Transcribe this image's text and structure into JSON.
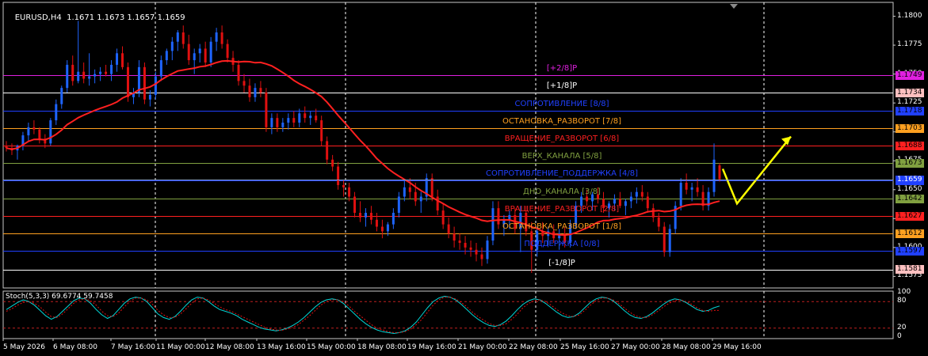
{
  "header": {
    "symbol": "EURUSD,H4",
    "ohlc": "1.1671 1.1673 1.1657 1.1659"
  },
  "stoch_header": "Stoch(5,3,3) 69.6774 59.7458",
  "colors": {
    "background": "#000000",
    "bull": "#1e64ff",
    "bear": "#e01010",
    "ma": "#ff2020",
    "stoch_main": "#00d8d8",
    "stoch_signal": "#e01010",
    "arrow": "#ffff00",
    "grid": "#ffffff"
  },
  "price_axis": {
    "ticks": [
      "1.1800",
      "1.1775",
      "1.1750",
      "1.1725",
      "1.1700",
      "1.1675",
      "1.1650",
      "1.1625",
      "1.1600",
      "1.1575"
    ],
    "min": 1.1565,
    "max": 1.1812
  },
  "stoch_axis": {
    "ticks": [
      "100",
      "80",
      "20",
      "0"
    ],
    "levels": [
      20,
      80
    ]
  },
  "levels": [
    {
      "label": "[+2/8]P",
      "price": 1.1749,
      "tag": "1.1749",
      "color": "#e020e0",
      "tagbg": "#e020e0"
    },
    {
      "label": "[+1/8]P",
      "price": 1.1734,
      "tag": "1.1734",
      "color": "#ffffff",
      "tagbg": "#ffc0c0"
    },
    {
      "label": "СОПРОТИВЛЕНИЕ [8/8]",
      "price": 1.1718,
      "tag": "1.1718",
      "color": "#2040ff",
      "tagbg": "#2040ff"
    },
    {
      "label": "ОСТАНОВКА_РАЗВОРОТ [7/8]",
      "price": 1.1703,
      "tag": "1.1703",
      "color": "#ffa020",
      "tagbg": "#ffa020"
    },
    {
      "label": "ВРАЩЕНИЕ_РАЗВОРОТ [6/8]",
      "price": 1.1688,
      "tag": "1.1688",
      "color": "#ff2020",
      "tagbg": "#ff2020"
    },
    {
      "label": "ВЕРХ_КАНАЛА [5/8]",
      "price": 1.1673,
      "tag": "1.1673",
      "color": "#80a040",
      "tagbg": "#80a040"
    },
    {
      "label": "СОПРОТИВЛЕНИЕ_ПОДДЕРЖКА [4/8]",
      "price": 1.1658,
      "tag": "1.1658",
      "color": "#2040ff",
      "tagbg": "#2040ff"
    },
    {
      "label": "ДНО_КАНАЛА [3/8]",
      "price": 1.1642,
      "tag": "1.1642",
      "color": "#80a040",
      "tagbg": "#80a040"
    },
    {
      "label": "ВРАЩЕНИЕ_РАЗВОРОТ [2/8]",
      "price": 1.1627,
      "tag": "1.1627",
      "color": "#ff2020",
      "tagbg": "#ff2020"
    },
    {
      "label": "ОСТАНОВКА_РАЗВОРОТ [1/8]",
      "price": 1.1612,
      "tag": "1.1612",
      "color": "#ffa020",
      "tagbg": "#ffa020"
    },
    {
      "label": "ПОДДЕРЖКА [0/8]",
      "price": 1.1597,
      "tag": "1.1597",
      "color": "#2040ff",
      "tagbg": "#2040ff"
    },
    {
      "label": "[-1/8]P",
      "price": 1.1581,
      "tag": "1.1581",
      "color": "#ffffff",
      "tagbg": "#ffc0c0"
    }
  ],
  "current_price": {
    "price": 1.1659,
    "tag": "1.1659"
  },
  "time_axis": [
    "5 May 2026",
    "6 May 08:00",
    "7 May 16:00",
    "11 May 00:00",
    "12 May 08:00",
    "13 May 16:00",
    "15 May 00:00",
    "18 May 08:00",
    "19 May 16:00",
    "21 May 00:00",
    "22 May 08:00",
    "25 May 16:00",
    "27 May 00:00",
    "28 May 08:00",
    "29 May 16:00"
  ],
  "chart_data": {
    "type": "candlestick",
    "candles": [
      [
        1.1688,
        1.1692,
        1.1683,
        1.1686
      ],
      [
        1.1686,
        1.169,
        1.168,
        1.1684
      ],
      [
        1.1684,
        1.1689,
        1.1676,
        1.1688
      ],
      [
        1.1688,
        1.17,
        1.1684,
        1.1697
      ],
      [
        1.1697,
        1.1708,
        1.1692,
        1.1704
      ],
      [
        1.1704,
        1.171,
        1.1698,
        1.1702
      ],
      [
        1.1702,
        1.1704,
        1.169,
        1.1694
      ],
      [
        1.1694,
        1.1698,
        1.1686,
        1.169
      ],
      [
        1.169,
        1.1712,
        1.1688,
        1.171
      ],
      [
        1.171,
        1.1728,
        1.1706,
        1.1724
      ],
      [
        1.1724,
        1.174,
        1.172,
        1.1738
      ],
      [
        1.1738,
        1.1762,
        1.1734,
        1.1758
      ],
      [
        1.1758,
        1.1766,
        1.174,
        1.1744
      ],
      [
        1.1744,
        1.1796,
        1.1742,
        1.1752
      ],
      [
        1.1752,
        1.176,
        1.1742,
        1.1746
      ],
      [
        1.1746,
        1.1768,
        1.174,
        1.1748
      ],
      [
        1.1748,
        1.1754,
        1.1742,
        1.175
      ],
      [
        1.175,
        1.1756,
        1.1744,
        1.1752
      ],
      [
        1.1752,
        1.1758,
        1.1748,
        1.175
      ],
      [
        1.175,
        1.1762,
        1.1744,
        1.1758
      ],
      [
        1.1758,
        1.1772,
        1.1752,
        1.1768
      ],
      [
        1.1768,
        1.1774,
        1.1754,
        1.1756
      ],
      [
        1.1756,
        1.176,
        1.1726,
        1.173
      ],
      [
        1.173,
        1.1738,
        1.1724,
        1.1734
      ],
      [
        1.1734,
        1.1762,
        1.173,
        1.1756
      ],
      [
        1.1756,
        1.176,
        1.1724,
        1.1728
      ],
      [
        1.1728,
        1.1736,
        1.1722,
        1.1732
      ],
      [
        1.1732,
        1.1752,
        1.1728,
        1.1748
      ],
      [
        1.1748,
        1.1766,
        1.1744,
        1.1762
      ],
      [
        1.1762,
        1.1772,
        1.1758,
        1.177
      ],
      [
        1.177,
        1.1782,
        1.1762,
        1.1778
      ],
      [
        1.1778,
        1.1788,
        1.177,
        1.1786
      ],
      [
        1.1786,
        1.1792,
        1.1772,
        1.1776
      ],
      [
        1.1776,
        1.1784,
        1.1758,
        1.1762
      ],
      [
        1.1762,
        1.1772,
        1.175,
        1.1768
      ],
      [
        1.1768,
        1.1776,
        1.176,
        1.1772
      ],
      [
        1.1772,
        1.1778,
        1.1756,
        1.176
      ],
      [
        1.176,
        1.1782,
        1.1756,
        1.1778
      ],
      [
        1.1778,
        1.179,
        1.177,
        1.1786
      ],
      [
        1.1786,
        1.1792,
        1.1772,
        1.1776
      ],
      [
        1.1776,
        1.178,
        1.176,
        1.1764
      ],
      [
        1.1764,
        1.177,
        1.1752,
        1.1758
      ],
      [
        1.1758,
        1.1762,
        1.174,
        1.1744
      ],
      [
        1.1744,
        1.175,
        1.1734,
        1.174
      ],
      [
        1.174,
        1.1746,
        1.1726,
        1.173
      ],
      [
        1.173,
        1.1742,
        1.1726,
        1.1738
      ],
      [
        1.1738,
        1.1744,
        1.173,
        1.1734
      ],
      [
        1.1734,
        1.1738,
        1.17,
        1.1704
      ],
      [
        1.1704,
        1.1716,
        1.1698,
        1.1712
      ],
      [
        1.1712,
        1.1716,
        1.17,
        1.1704
      ],
      [
        1.1704,
        1.1712,
        1.17,
        1.1708
      ],
      [
        1.1708,
        1.1716,
        1.1702,
        1.1712
      ],
      [
        1.1712,
        1.1718,
        1.1704,
        1.1708
      ],
      [
        1.1708,
        1.172,
        1.1704,
        1.1716
      ],
      [
        1.1716,
        1.1722,
        1.1708,
        1.1712
      ],
      [
        1.1712,
        1.1718,
        1.1706,
        1.1714
      ],
      [
        1.1714,
        1.172,
        1.1708,
        1.171
      ],
      [
        1.171,
        1.1714,
        1.1688,
        1.1692
      ],
      [
        1.1692,
        1.1696,
        1.1672,
        1.1676
      ],
      [
        1.1676,
        1.168,
        1.1666,
        1.167
      ],
      [
        1.167,
        1.1674,
        1.165,
        1.1654
      ],
      [
        1.1654,
        1.1658,
        1.1644,
        1.1652
      ],
      [
        1.1652,
        1.1656,
        1.164,
        1.1644
      ],
      [
        1.1644,
        1.1648,
        1.1626,
        1.163
      ],
      [
        1.163,
        1.164,
        1.1622,
        1.1626
      ],
      [
        1.1626,
        1.1634,
        1.1618,
        1.163
      ],
      [
        1.163,
        1.1636,
        1.162,
        1.1624
      ],
      [
        1.1624,
        1.163,
        1.1614,
        1.1618
      ],
      [
        1.1618,
        1.1624,
        1.1608,
        1.1614
      ],
      [
        1.1614,
        1.1622,
        1.161,
        1.162
      ],
      [
        1.162,
        1.1634,
        1.1616,
        1.163
      ],
      [
        1.163,
        1.1648,
        1.1626,
        1.1644
      ],
      [
        1.1644,
        1.1658,
        1.164,
        1.1652
      ],
      [
        1.1652,
        1.166,
        1.1642,
        1.1648
      ],
      [
        1.1648,
        1.1656,
        1.1636,
        1.164
      ],
      [
        1.164,
        1.1648,
        1.163,
        1.1644
      ],
      [
        1.1644,
        1.1664,
        1.164,
        1.166
      ],
      [
        1.166,
        1.1664,
        1.164,
        1.1644
      ],
      [
        1.1644,
        1.165,
        1.1628,
        1.1632
      ],
      [
        1.1632,
        1.1638,
        1.1616,
        1.162
      ],
      [
        1.162,
        1.1626,
        1.1608,
        1.1612
      ],
      [
        1.1612,
        1.1618,
        1.16,
        1.1606
      ],
      [
        1.1606,
        1.1612,
        1.1598,
        1.1604
      ],
      [
        1.1604,
        1.161,
        1.1594,
        1.16
      ],
      [
        1.16,
        1.1606,
        1.1592,
        1.1598
      ],
      [
        1.1598,
        1.1604,
        1.1588,
        1.1594
      ],
      [
        1.1594,
        1.16,
        1.1584,
        1.159
      ],
      [
        1.159,
        1.161,
        1.1586,
        1.1606
      ],
      [
        1.1606,
        1.164,
        1.1602,
        1.1634
      ],
      [
        1.1634,
        1.164,
        1.1616,
        1.162
      ],
      [
        1.162,
        1.1628,
        1.161,
        1.1624
      ],
      [
        1.1624,
        1.1632,
        1.1616,
        1.1628
      ],
      [
        1.1628,
        1.1634,
        1.1612,
        1.1616
      ],
      [
        1.1616,
        1.1636,
        1.1596,
        1.163
      ],
      [
        1.163,
        1.1636,
        1.161,
        1.1614
      ],
      [
        1.1614,
        1.1622,
        1.1578,
        1.1598
      ],
      [
        1.1598,
        1.1618,
        1.1592,
        1.1614
      ],
      [
        1.1614,
        1.1622,
        1.1604,
        1.161
      ],
      [
        1.161,
        1.1618,
        1.1602,
        1.1614
      ],
      [
        1.1614,
        1.162,
        1.1604,
        1.1608
      ],
      [
        1.1608,
        1.1616,
        1.1598,
        1.1612
      ],
      [
        1.1612,
        1.1618,
        1.16,
        1.1604
      ],
      [
        1.1604,
        1.1624,
        1.16,
        1.162
      ],
      [
        1.162,
        1.164,
        1.1616,
        1.1636
      ],
      [
        1.1636,
        1.1648,
        1.163,
        1.1644
      ],
      [
        1.1644,
        1.165,
        1.1636,
        1.164
      ],
      [
        1.164,
        1.1648,
        1.1632,
        1.1646
      ],
      [
        1.1646,
        1.1652,
        1.1638,
        1.1642
      ],
      [
        1.1642,
        1.1648,
        1.163,
        1.1634
      ],
      [
        1.1634,
        1.164,
        1.1626,
        1.1638
      ],
      [
        1.1638,
        1.1646,
        1.1632,
        1.1642
      ],
      [
        1.1642,
        1.1648,
        1.1634,
        1.1636
      ],
      [
        1.1636,
        1.1642,
        1.1628,
        1.164
      ],
      [
        1.164,
        1.1648,
        1.1634,
        1.1644
      ],
      [
        1.1644,
        1.1652,
        1.1638,
        1.1648
      ],
      [
        1.1648,
        1.1654,
        1.164,
        1.1644
      ],
      [
        1.1644,
        1.1648,
        1.163,
        1.1634
      ],
      [
        1.1634,
        1.1638,
        1.1622,
        1.1626
      ],
      [
        1.1626,
        1.163,
        1.1614,
        1.1618
      ],
      [
        1.1618,
        1.1622,
        1.1592,
        1.1596
      ],
      [
        1.1596,
        1.162,
        1.1592,
        1.1616
      ],
      [
        1.1616,
        1.164,
        1.1612,
        1.1636
      ],
      [
        1.1636,
        1.166,
        1.1632,
        1.1656
      ],
      [
        1.1656,
        1.1664,
        1.1646,
        1.165
      ],
      [
        1.165,
        1.1656,
        1.164,
        1.1652
      ],
      [
        1.1652,
        1.166,
        1.1644,
        1.1648
      ],
      [
        1.1648,
        1.1654,
        1.1632,
        1.1636
      ],
      [
        1.1636,
        1.1652,
        1.1632,
        1.1648
      ],
      [
        1.1648,
        1.169,
        1.1644,
        1.1676
      ],
      [
        1.1671,
        1.1673,
        1.1657,
        1.1659
      ]
    ],
    "stochastic": {
      "main": [
        62,
        70,
        78,
        84,
        80,
        72,
        60,
        48,
        40,
        46,
        58,
        70,
        82,
        88,
        86,
        76,
        62,
        50,
        42,
        48,
        62,
        76,
        86,
        90,
        88,
        80,
        66,
        52,
        44,
        40,
        46,
        58,
        72,
        84,
        90,
        88,
        80,
        70,
        62,
        58,
        54,
        48,
        40,
        34,
        28,
        22,
        18,
        16,
        14,
        16,
        20,
        26,
        34,
        44,
        56,
        68,
        78,
        84,
        86,
        84,
        76,
        64,
        52,
        40,
        30,
        22,
        16,
        12,
        10,
        8,
        10,
        14,
        22,
        34,
        50,
        66,
        80,
        88,
        92,
        90,
        84,
        74,
        62,
        50,
        40,
        32,
        26,
        24,
        28,
        36,
        48,
        62,
        74,
        82,
        86,
        84,
        76,
        66,
        56,
        48,
        44,
        46,
        54,
        66,
        78,
        86,
        90,
        88,
        82,
        72,
        60,
        50,
        44,
        42,
        46,
        54,
        64,
        74,
        82,
        86,
        84,
        78,
        70,
        62,
        58,
        60,
        66,
        70
      ],
      "signal": [
        58,
        64,
        72,
        78,
        80,
        76,
        68,
        56,
        46,
        44,
        52,
        64,
        76,
        84,
        86,
        82,
        72,
        58,
        48,
        46,
        54,
        68,
        80,
        88,
        88,
        84,
        74,
        60,
        50,
        44,
        44,
        52,
        64,
        76,
        86,
        88,
        84,
        76,
        68,
        62,
        58,
        52,
        46,
        40,
        34,
        28,
        22,
        18,
        16,
        15,
        18,
        22,
        28,
        38,
        48,
        60,
        72,
        80,
        84,
        84,
        80,
        70,
        58,
        48,
        38,
        28,
        20,
        16,
        12,
        10,
        10,
        12,
        18,
        28,
        40,
        56,
        72,
        84,
        90,
        90,
        86,
        78,
        68,
        56,
        46,
        38,
        30,
        26,
        26,
        30,
        40,
        52,
        66,
        76,
        82,
        84,
        80,
        72,
        62,
        54,
        48,
        46,
        50,
        60,
        72,
        82,
        88,
        88,
        84,
        76,
        66,
        56,
        48,
        44,
        44,
        50,
        58,
        68,
        76,
        82,
        84,
        80,
        74,
        66,
        60,
        58,
        60,
        60
      ]
    },
    "ma_period": 21
  }
}
